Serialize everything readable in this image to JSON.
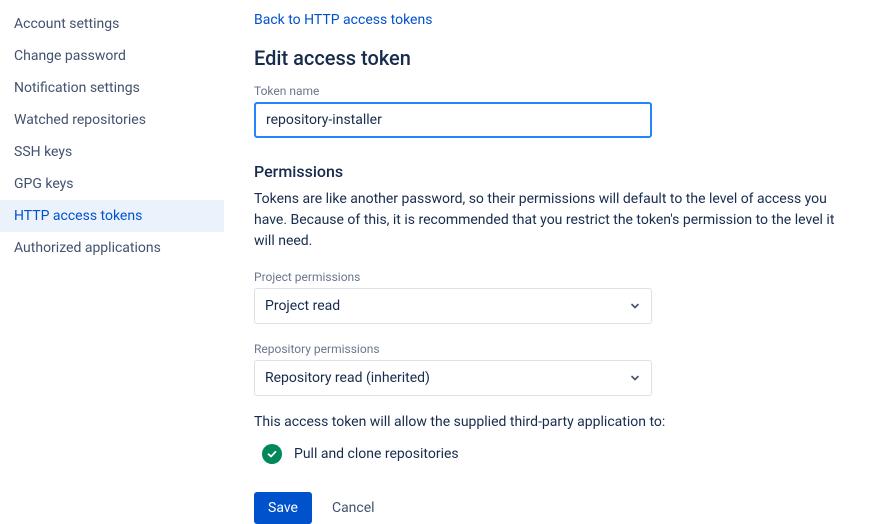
{
  "sidebar": {
    "items": [
      {
        "label": "Account settings",
        "active": false
      },
      {
        "label": "Change password",
        "active": false
      },
      {
        "label": "Notification settings",
        "active": false
      },
      {
        "label": "Watched repositories",
        "active": false
      },
      {
        "label": "SSH keys",
        "active": false
      },
      {
        "label": "GPG keys",
        "active": false
      },
      {
        "label": "HTTP access tokens",
        "active": true
      },
      {
        "label": "Authorized applications",
        "active": false
      }
    ]
  },
  "main": {
    "back_link": "Back to HTTP access tokens",
    "heading": "Edit access token",
    "token_name_label": "Token name",
    "token_name_value": "repository-installer",
    "permissions_heading": "Permissions",
    "permissions_desc": "Tokens are like another password, so their permissions will default to the level of access you have. Because of this, it is recommended that you restrict the token's permission to the level it will need.",
    "project_perm_label": "Project permissions",
    "project_perm_value": "Project read",
    "repo_perm_label": "Repository permissions",
    "repo_perm_value": "Repository read (inherited)",
    "allow_text": "This access token will allow the supplied third-party application to:",
    "perm_item": "Pull and clone repositories",
    "save_label": "Save",
    "cancel_label": "Cancel"
  }
}
